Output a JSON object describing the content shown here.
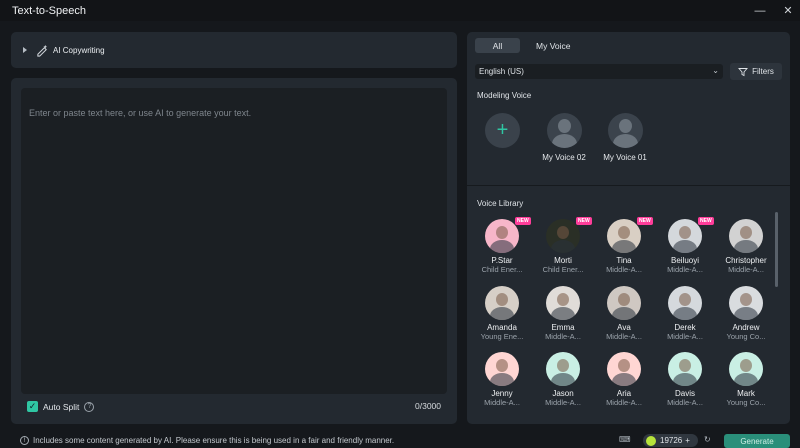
{
  "window": {
    "title": "Text-to-Speech",
    "minimize": "—",
    "close": "✕"
  },
  "copywriting": {
    "label": "AI Copywriting",
    "icon": "pen-sparkle-icon"
  },
  "editor": {
    "placeholder": "Enter or paste text here, or use AI to generate your text.",
    "auto_split_label": "Auto Split",
    "auto_split_checked": true,
    "counter": "0/3000"
  },
  "tabs": [
    {
      "label": "All",
      "active": true
    },
    {
      "label": "My Voice",
      "active": false
    }
  ],
  "language": {
    "selected": "English (US)"
  },
  "filters_label": "Filters",
  "modeling": {
    "title": "Modeling Voice",
    "add_icon": "plus-icon",
    "voices": [
      {
        "name": "My Voice 02"
      },
      {
        "name": "My Voice 01"
      }
    ]
  },
  "library": {
    "title": "Voice Library",
    "badge": "NEW",
    "voices": [
      {
        "name": "P.Star",
        "category": "Child Ener...",
        "is_new": true,
        "avatar_bg": "#f7b6c9"
      },
      {
        "name": "Morti",
        "category": "Child Ener...",
        "is_new": true,
        "avatar_bg": "#2a2f26"
      },
      {
        "name": "Tina",
        "category": "Middle-A...",
        "is_new": true,
        "avatar_bg": "#d9cfc4"
      },
      {
        "name": "Beiluoyi",
        "category": "Middle-A...",
        "is_new": true,
        "avatar_bg": "#d4d8dc"
      },
      {
        "name": "Christopher",
        "category": "Middle-A...",
        "is_new": false,
        "avatar_bg": "#d2d2d2"
      },
      {
        "name": "Amanda",
        "category": "Young Ene...",
        "is_new": false,
        "avatar_bg": "#d6cfc7"
      },
      {
        "name": "Emma",
        "category": "Middle-A...",
        "is_new": false,
        "avatar_bg": "#e0dcd8"
      },
      {
        "name": "Ava",
        "category": "Middle-A...",
        "is_new": false,
        "avatar_bg": "#cfc8c2"
      },
      {
        "name": "Derek",
        "category": "Middle-A...",
        "is_new": false,
        "avatar_bg": "#d5d9dd"
      },
      {
        "name": "Andrew",
        "category": "Young Co...",
        "is_new": false,
        "avatar_bg": "#d9dcdf"
      },
      {
        "name": "Jenny",
        "category": "Middle-A...",
        "is_new": false,
        "avatar_bg": "#ffd6d3"
      },
      {
        "name": "Jason",
        "category": "Middle-A...",
        "is_new": false,
        "avatar_bg": "#c9efe4"
      },
      {
        "name": "Aria",
        "category": "Middle-A...",
        "is_new": false,
        "avatar_bg": "#ffd6d3"
      },
      {
        "name": "Davis",
        "category": "Middle-A...",
        "is_new": false,
        "avatar_bg": "#c9efe4"
      },
      {
        "name": "Mark",
        "category": "Young Co...",
        "is_new": false,
        "avatar_bg": "#c9efe4"
      }
    ]
  },
  "footer": {
    "notice": "Includes some content generated by AI. Please ensure this is being used in a fair and friendly manner.",
    "credits": "19726",
    "generate_label": "Generate"
  },
  "colors": {
    "accent": "#2fc6a3",
    "panel": "#232930",
    "background": "#15181c",
    "badge": "#ff3d9a"
  }
}
